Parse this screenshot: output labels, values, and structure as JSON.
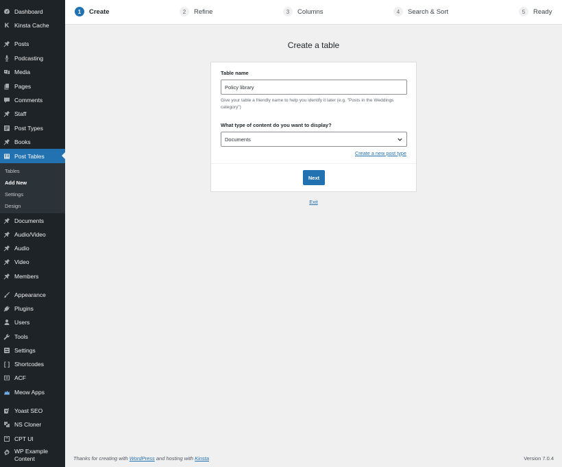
{
  "sidebar": {
    "items": [
      {
        "label": "Dashboard",
        "icon": "dashboard-icon"
      },
      {
        "label": "Kinsta Cache",
        "icon": "kinsta-icon"
      },
      {
        "label": "Posts",
        "icon": "pin-icon"
      },
      {
        "label": "Podcasting",
        "icon": "microphone-icon"
      },
      {
        "label": "Media",
        "icon": "media-icon"
      },
      {
        "label": "Pages",
        "icon": "pages-icon"
      },
      {
        "label": "Comments",
        "icon": "comments-icon"
      },
      {
        "label": "Staff",
        "icon": "pin-icon"
      },
      {
        "label": "Post Types",
        "icon": "post-types-icon"
      },
      {
        "label": "Books",
        "icon": "pin-icon"
      },
      {
        "label": "Post Tables",
        "icon": "table-icon",
        "active": true
      },
      {
        "label": "Documents",
        "icon": "pin-icon"
      },
      {
        "label": "Audio/Video",
        "icon": "pin-icon"
      },
      {
        "label": "Audio",
        "icon": "pin-icon"
      },
      {
        "label": "Video",
        "icon": "pin-icon"
      },
      {
        "label": "Members",
        "icon": "pin-icon"
      },
      {
        "label": "Appearance",
        "icon": "brush-icon"
      },
      {
        "label": "Plugins",
        "icon": "plugin-icon"
      },
      {
        "label": "Users",
        "icon": "user-icon"
      },
      {
        "label": "Tools",
        "icon": "wrench-icon"
      },
      {
        "label": "Settings",
        "icon": "settings-icon"
      },
      {
        "label": "Shortcodes",
        "icon": "shortcode-icon"
      },
      {
        "label": "ACF",
        "icon": "acf-icon"
      },
      {
        "label": "Meow Apps",
        "icon": "meow-icon"
      },
      {
        "label": "Yoast SEO",
        "icon": "yoast-icon"
      },
      {
        "label": "NS Cloner",
        "icon": "cloner-icon"
      },
      {
        "label": "CPT UI",
        "icon": "cpt-icon"
      },
      {
        "label": "WP Example",
        "label2": "Content",
        "icon": "gear-icon"
      }
    ],
    "submenu": [
      {
        "label": "Tables"
      },
      {
        "label": "Add New",
        "current": true
      },
      {
        "label": "Settings"
      },
      {
        "label": "Design"
      }
    ]
  },
  "steps": [
    {
      "num": "1",
      "label": "Create",
      "active": true
    },
    {
      "num": "2",
      "label": "Refine"
    },
    {
      "num": "3",
      "label": "Columns"
    },
    {
      "num": "4",
      "label": "Search & Sort"
    },
    {
      "num": "5",
      "label": "Ready"
    }
  ],
  "main": {
    "title": "Create a table",
    "table_name_label": "Table name",
    "table_name_value": "Policy library",
    "help_text": "Give your table a friendly name to help you identify it later (e.g. \"Posts in the Weddings category\")",
    "content_type_label": "What type of content do you want to display?",
    "content_type_value": "Documents",
    "create_post_type_link": "Create a new post type",
    "next_label": "Next",
    "exit_label": "Exit"
  },
  "footer": {
    "text1": "Thanks for creating with ",
    "link1": "WordPress",
    "text2": " and hosting with ",
    "link2": "Kinsta",
    "version": "Version 7.0.4"
  },
  "colors": {
    "sidebar_bg": "#1d2327",
    "accent": "#2271b1",
    "page_bg": "#f0f0f1"
  }
}
